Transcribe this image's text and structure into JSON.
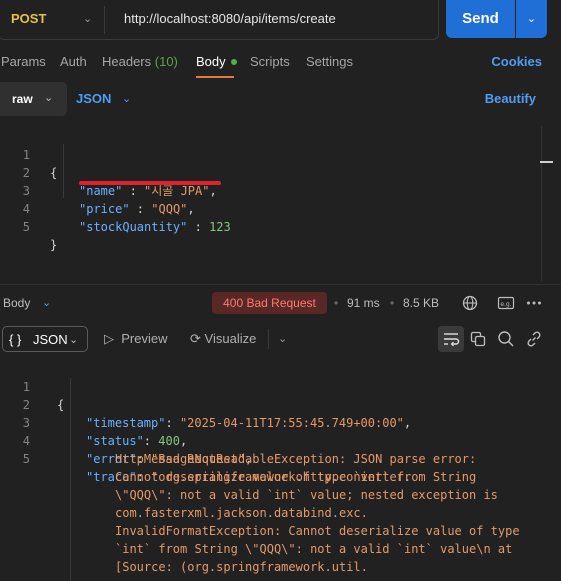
{
  "request": {
    "method": "POST",
    "url": "http://localhost:8080/api/items/create",
    "send_label": "Send"
  },
  "tabs": {
    "params": "Params",
    "auth": "Auth",
    "headers": "Headers",
    "headers_count": "(10)",
    "body": "Body",
    "scripts": "Scripts",
    "settings": "Settings",
    "cookies": "Cookies"
  },
  "body_type": {
    "mode": "raw",
    "language": "JSON",
    "beautify": "Beautify"
  },
  "request_body": {
    "line_numbers": [
      "1",
      "2",
      "3",
      "4",
      "5"
    ],
    "open": "{",
    "close": "}",
    "fields": [
      {
        "key": "\"name\"",
        "sep": " : ",
        "value": "\"시골 JPA\"",
        "trail": ","
      },
      {
        "key": "\"price\"",
        "sep": " : ",
        "value": "\"QQQ\"",
        "trail": ","
      },
      {
        "key": "\"stockQuantity\"",
        "sep": " : ",
        "value": "123",
        "trail": ""
      }
    ]
  },
  "response": {
    "label": "Body",
    "status": "400 Bad Request",
    "time": "91 ms",
    "size": "8.5 KB",
    "format": "JSON",
    "preview": "Preview",
    "visualize": "Visualize",
    "line_numbers": [
      "1",
      "2",
      "3",
      "4",
      "5"
    ],
    "open": "{",
    "lines": [
      {
        "key": "\"timestamp\"",
        "sep": ": ",
        "value": "\"2025-04-11T17:55:45.749+00:00\"",
        "trail": ","
      },
      {
        "key": "\"status\"",
        "sep": ": ",
        "value": "400",
        "trail": ","
      },
      {
        "key": "\"error\"",
        "sep": ": ",
        "value": "\"Bad Request\"",
        "trail": ","
      },
      {
        "key": "\"trace\"",
        "sep": ": ",
        "value": "\"org.springframework.http.converter.",
        "trail": ""
      }
    ],
    "trace_continuation": [
      "HttpMessageNotReadableException: JSON parse error:",
      "Cannot deserialize value of type `int` from String",
      "\\\"QQQ\\\": not a valid `int` value; nested exception is",
      "com.fasterxml.jackson.databind.exc.",
      "InvalidFormatException: Cannot deserialize value of type",
      "`int` from String \\\"QQQ\\\": not a valid `int` value\\n at",
      "[Source: (org.springframework.util."
    ]
  },
  "colors": {
    "accent": "#1f6fd6",
    "method": "#e8c046",
    "error_badge": "#582726",
    "error_text": "#ff7b6b",
    "json_key": "#6ab0ff",
    "json_string": "#e4996a",
    "json_number": "#7fc97f"
  }
}
